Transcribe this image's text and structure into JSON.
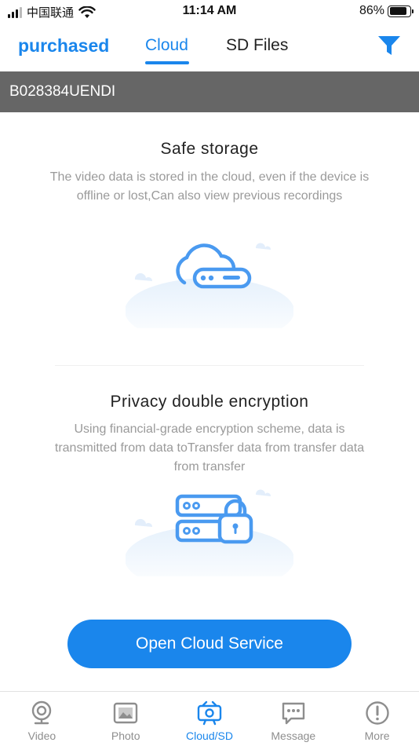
{
  "status_bar": {
    "carrier": "中国联通",
    "time": "11:14 AM",
    "battery": "86%",
    "battery_level": 0.86
  },
  "top_tabs": {
    "purchased": "purchased",
    "cloud": "Cloud",
    "sd_files": "SD Files",
    "active": "cloud"
  },
  "device": {
    "id": "B028384UENDI"
  },
  "features": [
    {
      "title": "Safe storage",
      "description": "The video data is stored in the cloud, even if the device is offline or lost,Can also view previous recordings",
      "icon": "cloud-server-icon"
    },
    {
      "title": "Privacy double encryption",
      "description": "Using financial-grade encryption scheme, data is transmitted from data toTransfer data from transfer data from transfer",
      "icon": "server-lock-icon"
    }
  ],
  "cta": {
    "label": "Open Cloud Service"
  },
  "bottom_nav": [
    {
      "label": "Video",
      "icon": "webcam-icon"
    },
    {
      "label": "Photo",
      "icon": "photo-icon"
    },
    {
      "label": "Cloud/SD",
      "icon": "camera-icon"
    },
    {
      "label": "Message",
      "icon": "message-icon"
    },
    {
      "label": "More",
      "icon": "exclamation-icon"
    }
  ],
  "colors": {
    "accent": "#1a86ec",
    "device_bar": "#666666",
    "muted_text": "#9a9a9a"
  }
}
